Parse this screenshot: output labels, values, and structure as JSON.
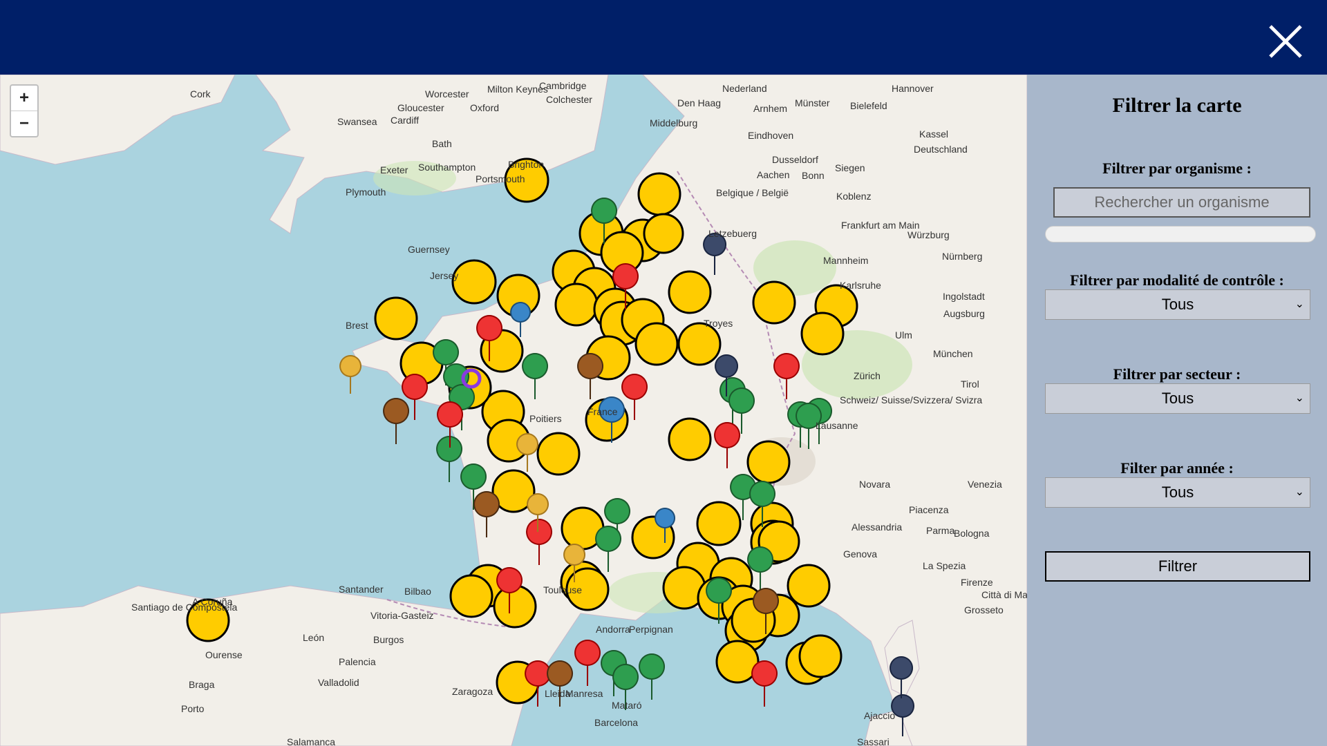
{
  "header": {
    "close_icon": "close-icon"
  },
  "map": {
    "zoom_in": "+",
    "zoom_out": "−",
    "labels": [
      {
        "text": "Cork"
      },
      {
        "text": "Worcester"
      },
      {
        "text": "Milton Keynes"
      },
      {
        "text": "Cambridge"
      },
      {
        "text": "Colchester"
      },
      {
        "text": "Gloucester"
      },
      {
        "text": "Oxford"
      },
      {
        "text": "Swansea"
      },
      {
        "text": "Cardiff"
      },
      {
        "text": "Bath"
      },
      {
        "text": "Exeter"
      },
      {
        "text": "Southampton"
      },
      {
        "text": "Brighton"
      },
      {
        "text": "Portsmouth"
      },
      {
        "text": "Plymouth"
      },
      {
        "text": "Guernsey"
      },
      {
        "text": "Jersey"
      },
      {
        "text": "Brest"
      },
      {
        "text": "Middelburg"
      },
      {
        "text": "Den Haag"
      },
      {
        "text": "Nederland"
      },
      {
        "text": "Arnhem"
      },
      {
        "text": "Münster"
      },
      {
        "text": "Bielefeld"
      },
      {
        "text": "Hannover"
      },
      {
        "text": "Eindhoven"
      },
      {
        "text": "Dusseldorf"
      },
      {
        "text": "Aachen"
      },
      {
        "text": "Siegen"
      },
      {
        "text": "Kassel"
      },
      {
        "text": "Bonn"
      },
      {
        "text": "Deutschland"
      },
      {
        "text": "Belgique / België"
      },
      {
        "text": "Koblenz"
      },
      {
        "text": "Frankfurt am Main"
      },
      {
        "text": "Letzebuerg"
      },
      {
        "text": "Würzburg"
      },
      {
        "text": "Mannheim"
      },
      {
        "text": "Nürnberg"
      },
      {
        "text": "Karlsruhe"
      },
      {
        "text": "Ingolstadt"
      },
      {
        "text": "Augsburg"
      },
      {
        "text": "Ulm"
      },
      {
        "text": "München"
      },
      {
        "text": "Troyes"
      },
      {
        "text": "France"
      },
      {
        "text": "Poitiers"
      },
      {
        "text": "Zürich"
      },
      {
        "text": "Schweiz/ Suisse/Svizzera/ Svizra"
      },
      {
        "text": "Lausanne"
      },
      {
        "text": "Tirol"
      },
      {
        "text": "Novara"
      },
      {
        "text": "Venezia"
      },
      {
        "text": "Piacenza"
      },
      {
        "text": "Alessandria"
      },
      {
        "text": "Parma"
      },
      {
        "text": "Bologna"
      },
      {
        "text": "Genova"
      },
      {
        "text": "La Spezia"
      },
      {
        "text": "Firenze"
      },
      {
        "text": "Grosseto"
      },
      {
        "text": "Città di Marino"
      },
      {
        "text": "Toulouse"
      },
      {
        "text": "Andorra"
      },
      {
        "text": "Perpignan"
      },
      {
        "text": "Santander"
      },
      {
        "text": "Bilbao"
      },
      {
        "text": "Vitoria-Gasteiz"
      },
      {
        "text": "A Coruña"
      },
      {
        "text": "Santiago de Compostela"
      },
      {
        "text": "León"
      },
      {
        "text": "Burgos"
      },
      {
        "text": "Ourense"
      },
      {
        "text": "Palencia"
      },
      {
        "text": "Braga"
      },
      {
        "text": "Valladolid"
      },
      {
        "text": "Porto"
      },
      {
        "text": "Zaragoza"
      },
      {
        "text": "Lleida"
      },
      {
        "text": "Manresa"
      },
      {
        "text": "Mataró"
      },
      {
        "text": "Barcelona"
      },
      {
        "text": "Salamanca"
      },
      {
        "text": "Ajaccio"
      },
      {
        "text": "Sassari"
      }
    ]
  },
  "panel": {
    "title": "Filtrer la carte",
    "organisme_label": "Filtrer par organisme :",
    "organisme_placeholder": "Rechercher un organisme",
    "modalite_label": "Filtrer par modalité de contrôle :",
    "modalite_value": "Tous",
    "secteur_label": "Filtrer par secteur :",
    "secteur_value": "Tous",
    "annee_label": "Filter par année :",
    "annee_value": "Tous",
    "submit_label": "Filtrer"
  },
  "colors": {
    "header": "#001f68",
    "panel": "#a8b7cb",
    "cluster": "#ffcc00",
    "green_marker": "#2e9e4f",
    "red_marker": "#e33",
    "brown_marker": "#9b5a22",
    "blue_marker": "#3a86c8"
  }
}
